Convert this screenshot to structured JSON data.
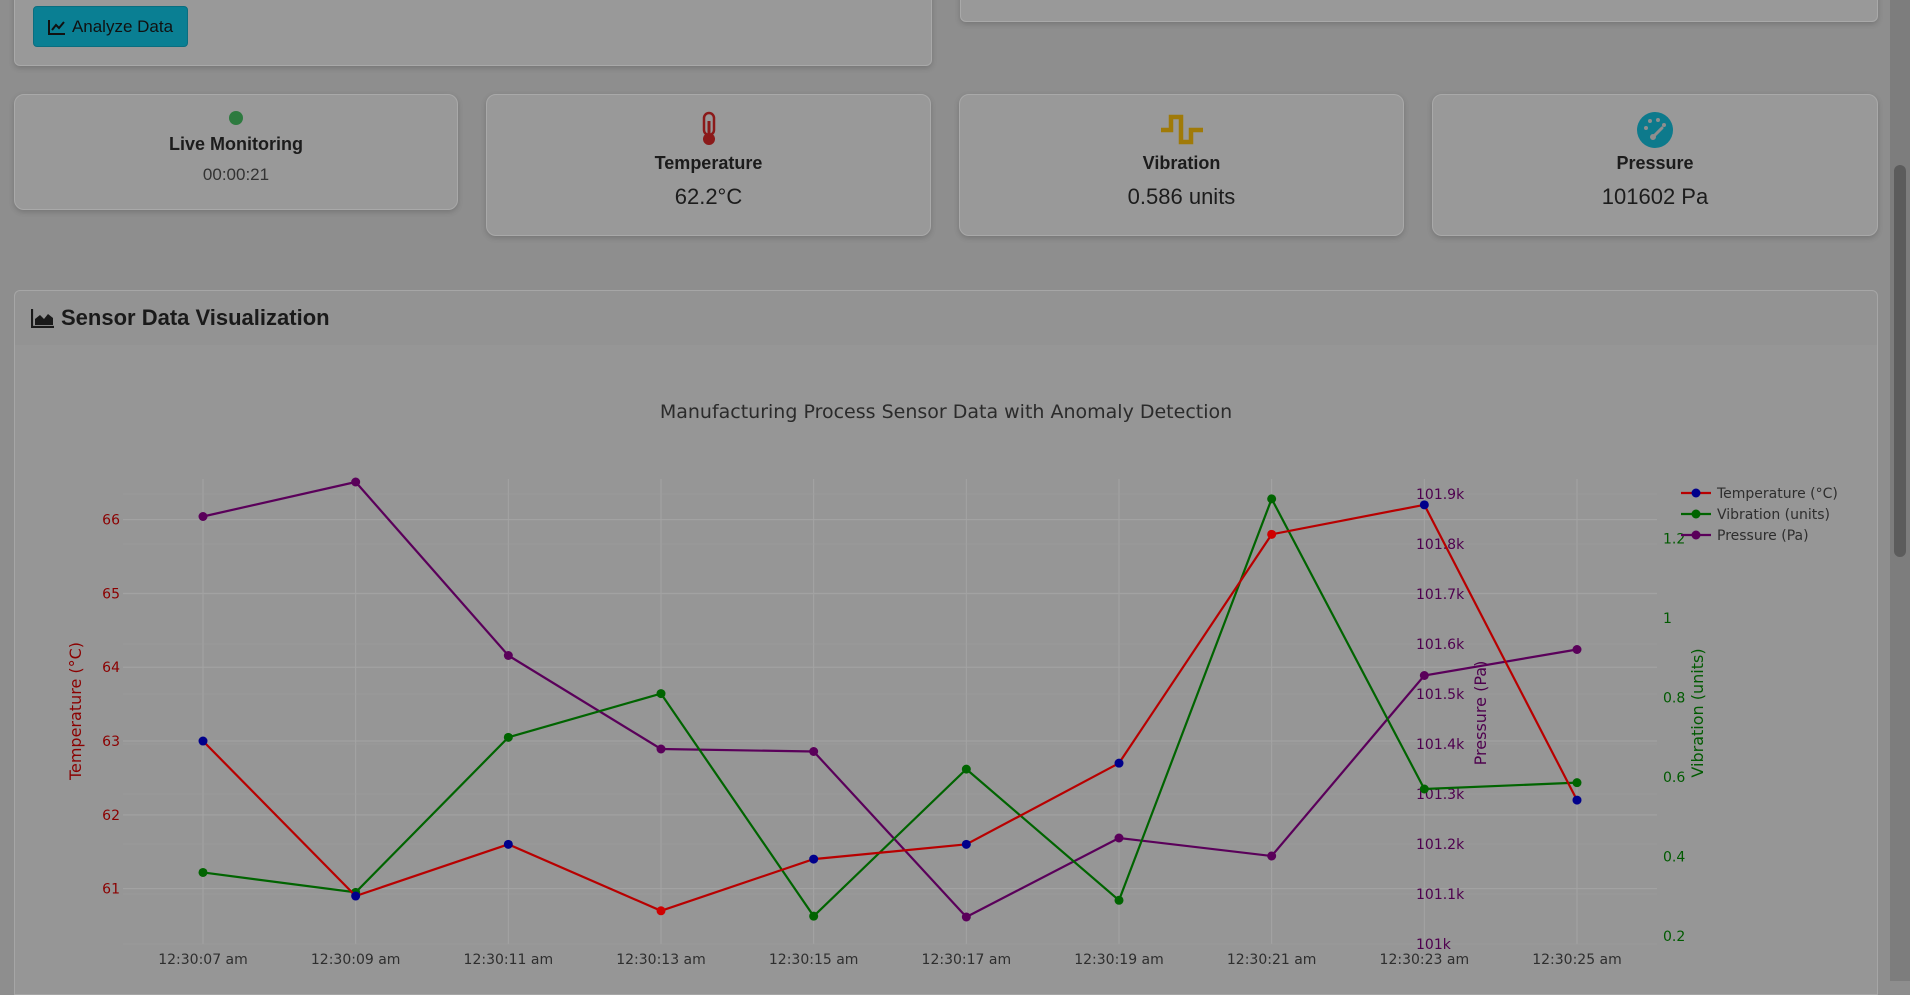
{
  "toolbar": {
    "analyze_label": "Analyze Data"
  },
  "stats": {
    "live": {
      "title": "Live Monitoring",
      "value": "00:00:21"
    },
    "temperature": {
      "title": "Temperature",
      "value": "62.2°C"
    },
    "vibration": {
      "title": "Vibration",
      "value": "0.586 units"
    },
    "pressure": {
      "title": "Pressure",
      "value": "101602 Pa"
    }
  },
  "section": {
    "title": "Sensor Data Visualization"
  },
  "colors": {
    "temperature": "#b80000",
    "vibration": "#006400",
    "pressure": "#5a005a",
    "anomaly": "#d00000",
    "normal": "#00008b"
  },
  "chart_data": {
    "type": "line",
    "title": "Manufacturing Process Sensor Data with Anomaly Detection",
    "x": [
      "12:30:07 am",
      "12:30:09 am",
      "12:30:11 am",
      "12:30:13 am",
      "12:30:15 am",
      "12:30:17 am",
      "12:30:19 am",
      "12:30:21 am",
      "12:30:23 am",
      "12:30:25 am"
    ],
    "series": [
      {
        "name": "Temperature (°C)",
        "axis": "left",
        "values": [
          63.0,
          60.9,
          61.6,
          60.7,
          61.4,
          61.6,
          62.7,
          65.8,
          66.2,
          62.2
        ],
        "anomaly": [
          false,
          false,
          false,
          true,
          false,
          false,
          false,
          true,
          false,
          false
        ]
      },
      {
        "name": "Vibration (units)",
        "axis": "right",
        "values": [
          0.36,
          0.31,
          0.7,
          0.81,
          0.25,
          0.62,
          0.29,
          1.3,
          0.57,
          0.586
        ]
      },
      {
        "name": "Pressure (Pa)",
        "axis": "right2",
        "values": [
          101855,
          101924,
          101577,
          101390,
          101385,
          101054,
          101212,
          101176,
          101537,
          101589
        ]
      }
    ],
    "ylabel_left": "Temperature (°C)",
    "ylabel_right": "Vibration (units)",
    "ylabel_right2": "Pressure (Pa)",
    "yticks_left": [
      "61",
      "62",
      "63",
      "64",
      "65",
      "66"
    ],
    "yticks_right": [
      "0.2",
      "0.4",
      "0.6",
      "0.8",
      "1",
      "1.2"
    ],
    "yticks_right2": [
      "101k",
      "101.1k",
      "101.2k",
      "101.3k",
      "101.4k",
      "101.5k",
      "101.6k",
      "101.7k",
      "101.8k",
      "101.9k"
    ],
    "ylim_left": [
      60.25,
      66.55
    ],
    "ylim_right": [
      0.18,
      1.35
    ],
    "ylim_right2": [
      101000,
      101930
    ],
    "grid": true,
    "legend": "top-right"
  }
}
